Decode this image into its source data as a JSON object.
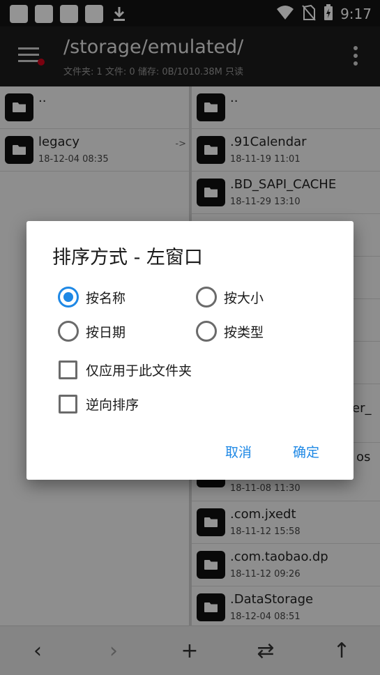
{
  "status_bar": {
    "time": "9:17",
    "icons": [
      "notification-square-icon",
      "notification-square-icon",
      "notification-square-icon",
      "notification-square-icon",
      "download-icon",
      "wifi-icon",
      "no-sim-icon",
      "battery-charging-icon"
    ]
  },
  "toolbar": {
    "title": "/storage/emulated/",
    "subtitle": "文件夹: 1  文件: 0  储存: 0B/1010.38M  只读"
  },
  "left_pane": {
    "rows": [
      {
        "name": "..",
        "date": "",
        "arrow": ""
      },
      {
        "name": "legacy",
        "date": "18-12-04 08:35",
        "arrow": "->"
      }
    ]
  },
  "right_pane": {
    "rows": [
      {
        "name": "..",
        "date": ""
      },
      {
        "name": ".91Calendar",
        "date": "18-11-19 11:01"
      },
      {
        "name": ".BD_SAPI_CACHE",
        "date": "18-11-29 13:10"
      },
      {
        "name": "",
        "date": ""
      },
      {
        "name": "",
        "date": ""
      },
      {
        "name": "",
        "date": ""
      },
      {
        "name": "",
        "date": ""
      },
      {
        "name": "er_",
        "date": ""
      },
      {
        "name": "os",
        "date": "18-11-08 11:30"
      },
      {
        "name": ".com.jxedt",
        "date": "18-11-12 15:58"
      },
      {
        "name": ".com.taobao.dp",
        "date": "18-11-12 09:26"
      },
      {
        "name": ".DataStorage",
        "date": "18-12-04 08:51"
      }
    ]
  },
  "dialog": {
    "title": "排序方式 - 左窗口",
    "sort_options": [
      {
        "label": "按名称",
        "selected": true
      },
      {
        "label": "按大小",
        "selected": false
      },
      {
        "label": "按日期",
        "selected": false
      },
      {
        "label": "按类型",
        "selected": false
      }
    ],
    "checkboxes": [
      {
        "label": "仅应用于此文件夹",
        "checked": false
      },
      {
        "label": "逆向排序",
        "checked": false
      }
    ],
    "cancel_label": "取消",
    "ok_label": "确定"
  },
  "nav": {
    "back": "‹",
    "forward": "›",
    "add": "+",
    "swap": "⇄",
    "up": "↑"
  },
  "colors": {
    "accent": "#1e88e5",
    "toolbar_bg": "#1c1c1c",
    "statusbar_bg": "#141414"
  }
}
